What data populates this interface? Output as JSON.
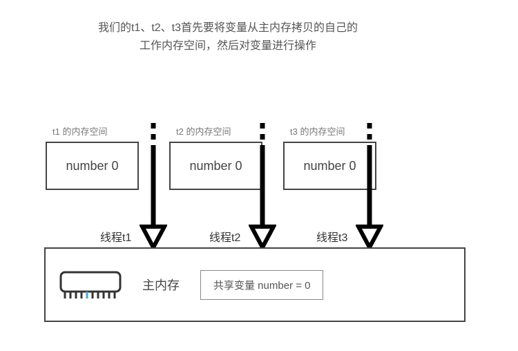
{
  "description": {
    "line1": "我们的t1、t2、t3首先要将变量从主内存拷贝的自己的",
    "line2": "工作内存空间，然后对变量进行操作"
  },
  "threads": [
    {
      "label": "t1 的内存空间",
      "box": "number 0",
      "name": "线程t1"
    },
    {
      "label": "t2 的内存空间",
      "box": "number 0",
      "name": "线程t2"
    },
    {
      "label": "t3 的内存空间",
      "box": "number 0",
      "name": "线程t3"
    }
  ],
  "main_memory": {
    "label": "主内存",
    "shared_var": "共享变量 number = 0"
  },
  "icons": {
    "ram": "ram-icon",
    "arrow": "arrow-down-icon"
  }
}
